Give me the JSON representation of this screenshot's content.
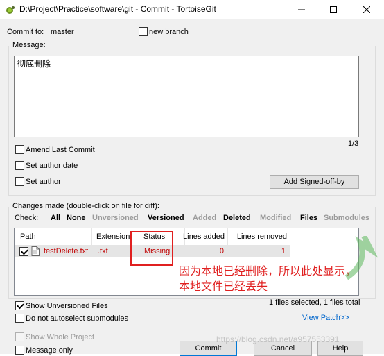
{
  "window": {
    "title": "D:\\Project\\Practice\\software\\git - Commit - TortoiseGit"
  },
  "commit": {
    "commit_to_label": "Commit to:",
    "branch": "master",
    "new_branch_label": "new branch"
  },
  "message": {
    "group_label": "Message:",
    "text": "彻底删除",
    "position": "1/3"
  },
  "options": {
    "amend_label": "Amend Last Commit",
    "author_date_label": "Set author date",
    "author_label": "Set author",
    "signoff_button": "Add Signed-off-by"
  },
  "changes": {
    "group_label": "Changes made (double-click on file for diff):",
    "check_label": "Check:",
    "filters": [
      "All",
      "None",
      "Unversioned",
      "Versioned",
      "Added",
      "Deleted",
      "Modified",
      "Files",
      "Submodules"
    ],
    "columns": [
      "Path",
      "Extension",
      "Status",
      "Lines added",
      "Lines removed"
    ],
    "rows": [
      {
        "checked": true,
        "path": "testDelete.txt",
        "extension": ".txt",
        "status": "Missing",
        "lines_added": "0",
        "lines_removed": "1"
      }
    ],
    "selection_summary": "1 files selected, 1 files total",
    "view_patch_link": "View Patch>>"
  },
  "annotation": {
    "text": "因为本地已经删除，所以此处显示，本地文件已经丢失",
    "color": "#e02020"
  },
  "bottom": {
    "show_unversioned_label": "Show Unversioned Files",
    "no_autoselect_label": "Do not autoselect submodules",
    "show_whole_project_label": "Show Whole Project",
    "message_only_label": "Message only",
    "commit_button": "Commit",
    "cancel_button": "Cancel",
    "help_button": "Help",
    "watermark": "https://blog.csdn.net/a957553391"
  }
}
